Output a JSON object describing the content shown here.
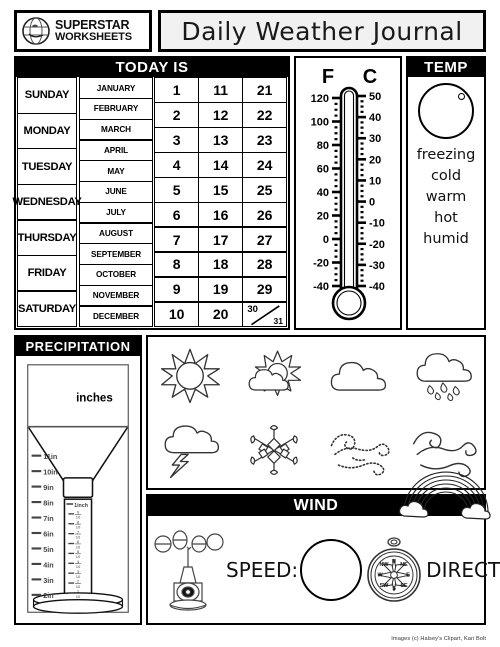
{
  "header": {
    "logo_line1": "SUPERSTAR",
    "logo_line2": "WORKSHEETS",
    "title": "Daily Weather Journal"
  },
  "today": {
    "caption": "TODAY IS",
    "days": [
      "SUNDAY",
      "MONDAY",
      "TUESDAY",
      "WEDNESDAY",
      "THURSDAY",
      "FRIDAY",
      "SATURDAY"
    ],
    "months": [
      "JANUARY",
      "FEBRUARY",
      "MARCH",
      "APRIL",
      "MAY",
      "JUNE",
      "JULY",
      "AUGUST",
      "SEPTEMBER",
      "OCTOBER",
      "NOVEMBER",
      "DECEMBER"
    ],
    "dates_col1": [
      "1",
      "2",
      "3",
      "4",
      "5",
      "6",
      "7",
      "8",
      "9",
      "10"
    ],
    "dates_col2": [
      "11",
      "12",
      "13",
      "14",
      "15",
      "16",
      "17",
      "18",
      "19",
      "20"
    ],
    "dates_col3": [
      "21",
      "22",
      "23",
      "24",
      "25",
      "26",
      "27",
      "28",
      "29"
    ],
    "date_split_a": "30",
    "date_split_b": "31"
  },
  "thermometer": {
    "f_label": "F",
    "c_label": "C",
    "f_ticks": [
      "120",
      "100",
      "80",
      "60",
      "40",
      "20",
      "0",
      "-20",
      "-40"
    ],
    "c_ticks": [
      "50",
      "40",
      "30",
      "20",
      "10",
      "0",
      "-10",
      "-20",
      "-30",
      "-40"
    ]
  },
  "temp": {
    "caption": "TEMP",
    "options": [
      "freezing",
      "cold",
      "warm",
      "hot",
      "humid"
    ]
  },
  "precipitation": {
    "caption": "PRECIPITATION",
    "units_label": "inches",
    "outer_ticks": [
      "11in",
      "10in",
      "9in",
      "8in",
      "7in",
      "6in",
      "5in",
      "4in",
      "3in",
      "2in"
    ],
    "inner_top_label": "1inch",
    "inner_ticks": [
      "9/10",
      "8/10",
      "7/10",
      "6/10",
      "5/10",
      "4/10",
      "3/10",
      "2/10",
      "1/10"
    ]
  },
  "weather_icons": [
    {
      "name": "sunny-icon",
      "label": "sunny"
    },
    {
      "name": "partly-cloudy-icon",
      "label": "partly cloudy"
    },
    {
      "name": "cloudy-icon",
      "label": "cloudy"
    },
    {
      "name": "rainy-icon",
      "label": "rainy"
    },
    {
      "name": "stormy-icon",
      "label": "stormy"
    },
    {
      "name": "snowy-icon",
      "label": "snowy"
    },
    {
      "name": "windy-dotted-icon",
      "label": "windy"
    },
    {
      "name": "windy-solid-icon",
      "label": "breezy"
    }
  ],
  "wind": {
    "caption": "WIND",
    "speed_label": "SPEED:",
    "direction_label": "DIRECTION:",
    "compass_points": [
      "N",
      "NE",
      "E",
      "SE",
      "S",
      "SW",
      "W",
      "NW"
    ]
  },
  "footer": {
    "credit": "Images (c) Halsey's Clipart, Kari Bolt"
  },
  "colors": {
    "ink": "#000000",
    "paper": "#ffffff",
    "title_bg": "#f1f1f1"
  }
}
